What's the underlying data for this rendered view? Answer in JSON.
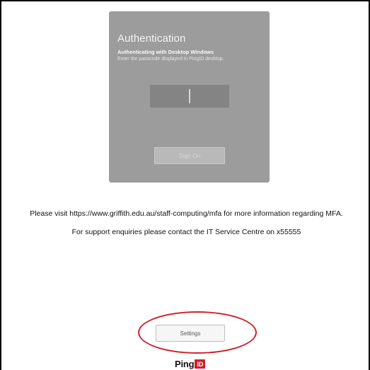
{
  "auth": {
    "title": "Authentication",
    "subtitle": "Authenticating with Desktop Windows",
    "description": "Enter the passcode displayed in PingID desktop.",
    "passcode_value": "",
    "sign_on_label": "Sign On"
  },
  "info": {
    "line1": "Please visit https://www.griffith.edu.au/staff-computing/mfa for more information regarding MFA.",
    "line2": "For support enquiries please contact the IT Service Centre on x55555"
  },
  "settings": {
    "label": "Settings"
  },
  "logo": {
    "ping": "Ping",
    "id": "ID"
  },
  "colors": {
    "card_bg": "#9c9c9c",
    "highlight": "#d0202a",
    "logo_red": "#d0202a"
  }
}
